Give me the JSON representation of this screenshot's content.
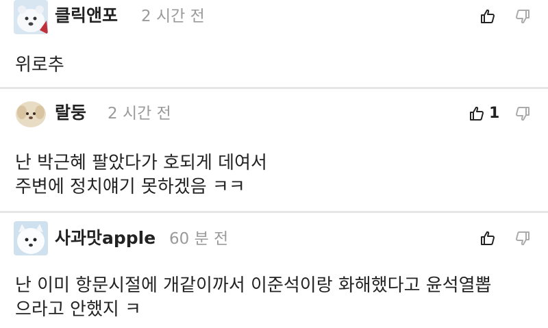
{
  "comments": [
    {
      "username": "클릭앤포",
      "time": "2 시간 전",
      "body": "위로추",
      "likes": "",
      "avatar": "polar-bear-avatar"
    },
    {
      "username": "랄둥",
      "time": "2 시간 전",
      "body": "난 박근혜 팔았다가 호되게 데여서\n주변에 정치얘기 못하겠음 ㅋㅋ",
      "likes": "1",
      "avatar": "puppy-avatar"
    },
    {
      "username": "사과맛apple",
      "time": "60 분 전",
      "body": "난 이미 항문시절에 개같이까서 이준석이랑 화해했다고 윤석열뽑\n으라고 안했지 ㅋ",
      "likes": "",
      "avatar": "white-dog-avatar"
    }
  ],
  "icons": {
    "like": "thumbs-up-icon",
    "dislike": "thumbs-down-icon"
  }
}
